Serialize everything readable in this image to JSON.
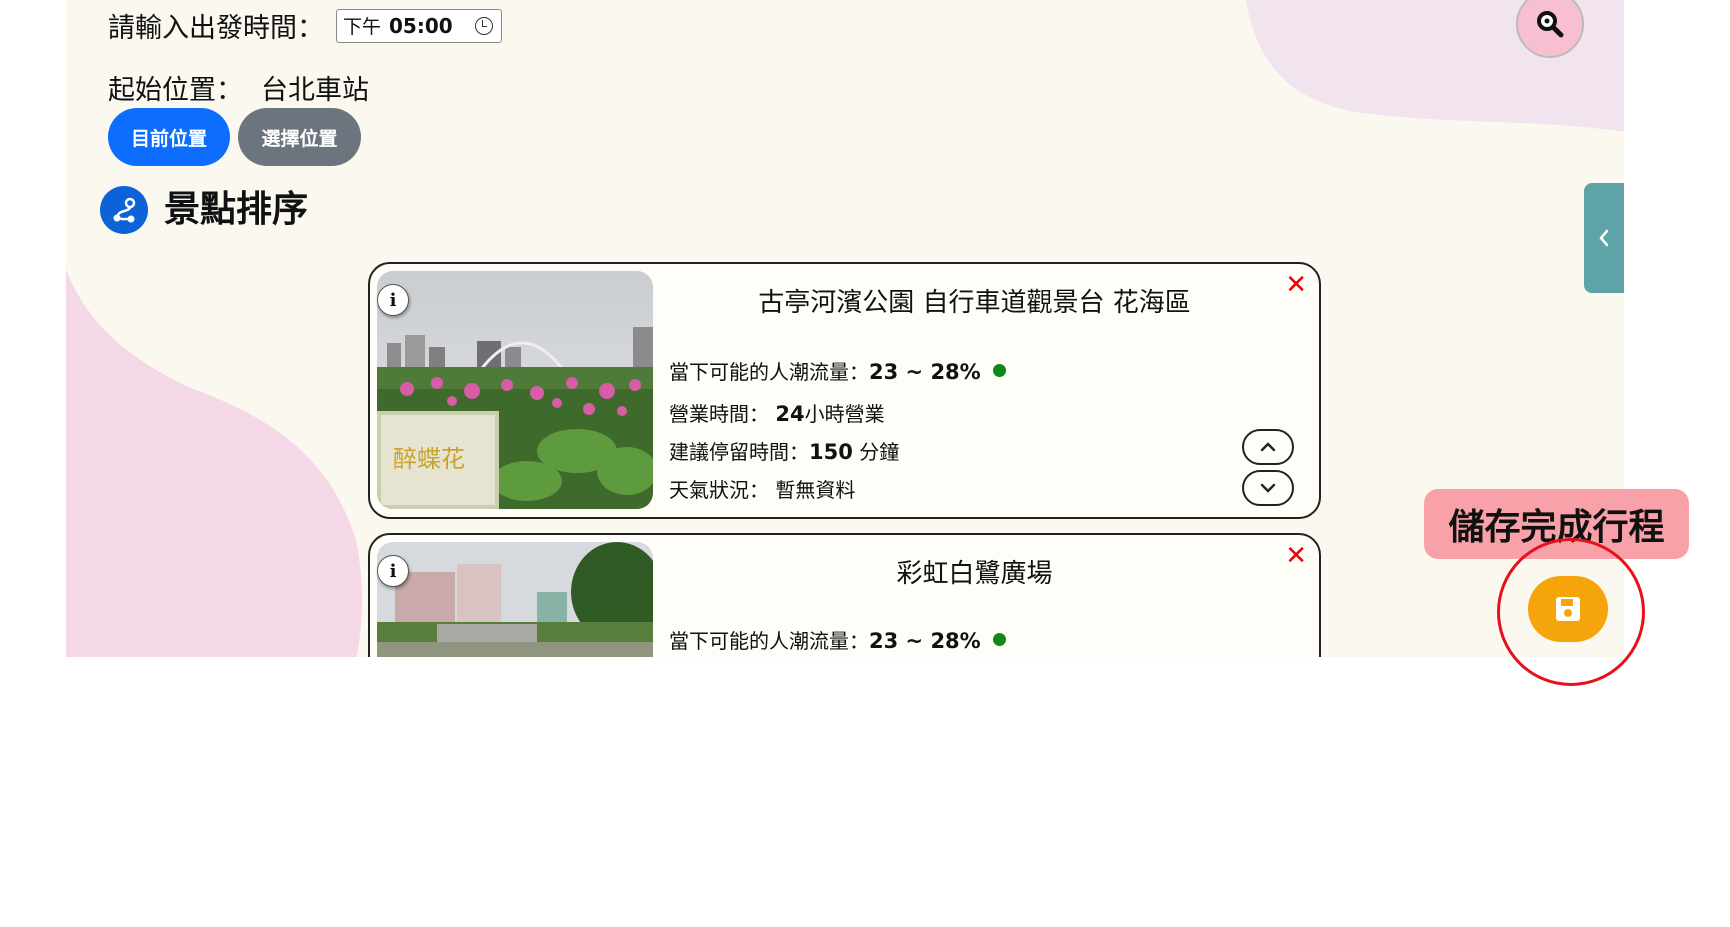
{
  "departure": {
    "label": "請輸入出發時間：",
    "ampm": "下午",
    "time": "05:00"
  },
  "start": {
    "label": "起始位置：",
    "value": "台北車站"
  },
  "location_buttons": {
    "current": "目前位置",
    "select": "選擇位置"
  },
  "section": {
    "title": "景點排序"
  },
  "attractions": [
    {
      "title": "古亭河濱公園 自行車道觀景台 花海區",
      "crowd_label": "當下可能的人潮流量：",
      "crowd_value": "23 ~ 28%",
      "hours_label": "營業時間：",
      "hours_num": "24",
      "hours_unit": "小時營業",
      "stay_label": "建議停留時間：",
      "stay_value": "150",
      "stay_unit": "分鐘",
      "weather_label": "天氣狀況：",
      "weather_value": "暫無資料",
      "photo_sign": "醉蝶花"
    },
    {
      "title": "彩虹白鷺廣場",
      "crowd_label": "當下可能的人潮流量：",
      "crowd_value": "23 ~ 28%"
    }
  ],
  "save": {
    "label": "儲存完成行程"
  },
  "icons": {
    "search": "search-icon",
    "route": "route-icon",
    "info": "info-icon",
    "close": "close-icon",
    "up": "chevron-up-icon",
    "down": "chevron-down-icon",
    "collapse": "chevron-left-icon",
    "save": "floppy-disk-icon"
  },
  "colors": {
    "primary": "#0d6efd",
    "secondary": "#6c757d",
    "status_green": "#0b8a16",
    "save": "#f5a40a",
    "highlight": "#e8101a"
  }
}
